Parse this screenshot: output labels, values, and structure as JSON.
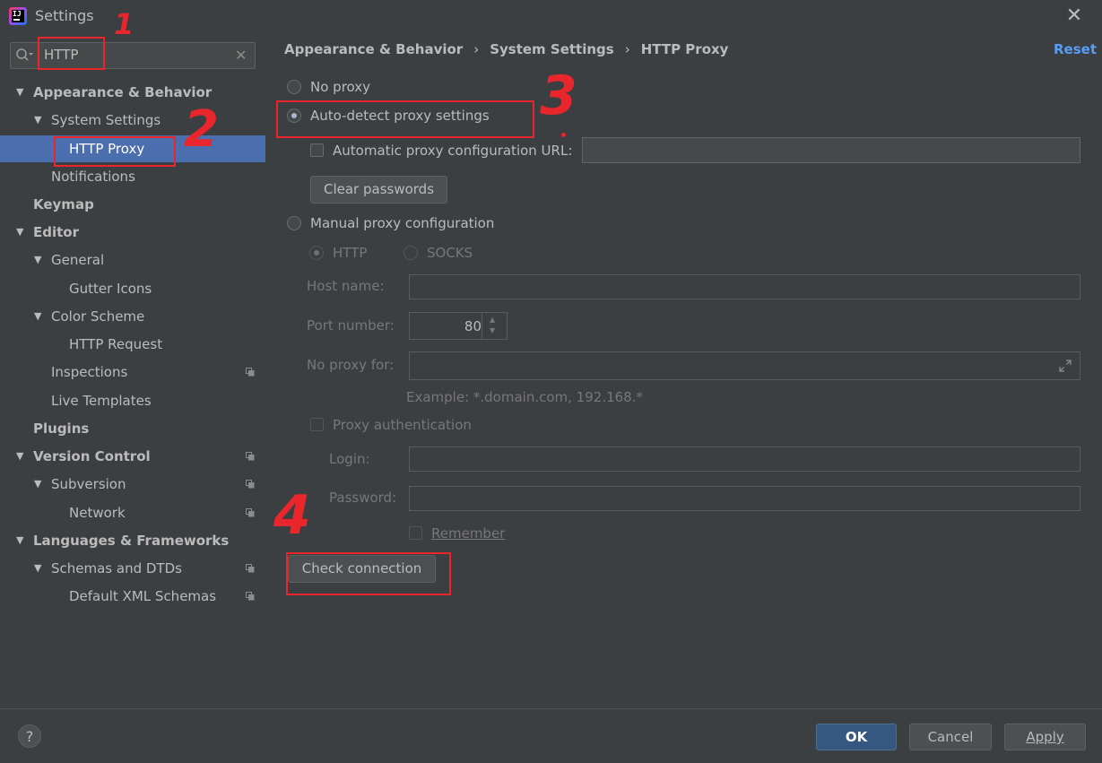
{
  "window": {
    "title": "Settings"
  },
  "search": {
    "value": "HTTP"
  },
  "sidebar": {
    "items": [
      {
        "label": "Appearance & Behavior",
        "arrow": "▼"
      },
      {
        "label": "System Settings",
        "arrow": "▼"
      },
      {
        "label": "HTTP Proxy"
      },
      {
        "label": "Notifications"
      },
      {
        "label": "Keymap"
      },
      {
        "label": "Editor",
        "arrow": "▼"
      },
      {
        "label": "General",
        "arrow": "▼"
      },
      {
        "label": "Gutter Icons"
      },
      {
        "label": "Color Scheme",
        "arrow": "▼"
      },
      {
        "label": "HTTP Request"
      },
      {
        "label": "Inspections"
      },
      {
        "label": "Live Templates"
      },
      {
        "label": "Plugins"
      },
      {
        "label": "Version Control",
        "arrow": "▼"
      },
      {
        "label": "Subversion",
        "arrow": "▼"
      },
      {
        "label": "Network"
      },
      {
        "label": "Languages & Frameworks",
        "arrow": "▼"
      },
      {
        "label": "Schemas and DTDs",
        "arrow": "▼"
      },
      {
        "label": "Default XML Schemas"
      }
    ]
  },
  "breadcrumb": {
    "part1": "Appearance & Behavior",
    "part2": "System Settings",
    "part3": "HTTP Proxy",
    "sep": "›"
  },
  "reset_label": "Reset",
  "proxy": {
    "no_proxy": "No proxy",
    "auto_detect": "Auto-detect proxy settings",
    "auto_config_url": "Automatic proxy configuration URL:",
    "clear_passwords": "Clear passwords",
    "manual": "Manual proxy configuration",
    "http": "HTTP",
    "socks": "SOCKS",
    "host_name": "Host name:",
    "port_number": "Port number:",
    "port_value": "80",
    "no_proxy_for": "No proxy for:",
    "example": "Example: *.domain.com, 192.168.*",
    "proxy_auth": "Proxy authentication",
    "login": "Login:",
    "password": "Password:",
    "remember": "Remember",
    "check_connection": "Check connection"
  },
  "annotations": {
    "n1": "1",
    "n2": "2",
    "n3": "3",
    "n4": "4"
  },
  "footer": {
    "help": "?",
    "ok": "OK",
    "cancel": "Cancel",
    "apply": "Apply"
  },
  "colors": {
    "selection": "#4b6eaf",
    "accent_link": "#589df6",
    "annotation": "#e8262b",
    "primary_button": "#365880"
  }
}
